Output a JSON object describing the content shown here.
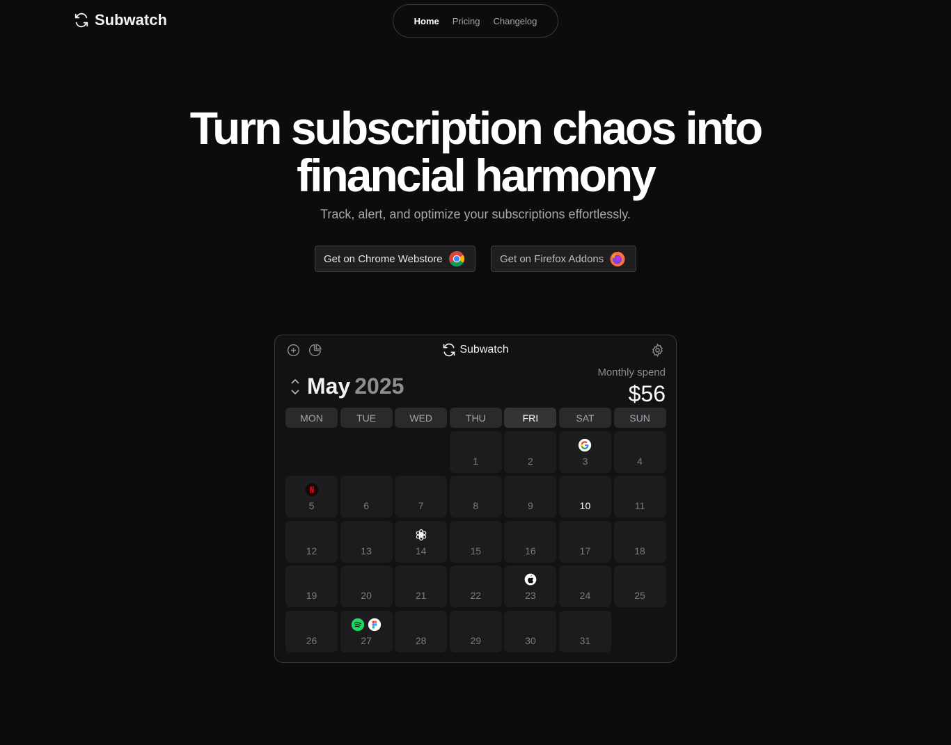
{
  "brand": {
    "name": "Subwatch"
  },
  "nav": {
    "items": [
      "Home",
      "Pricing",
      "Changelog"
    ]
  },
  "hero": {
    "title_line1": "Turn subscription chaos into",
    "title_line2": "financial harmony",
    "subtitle": "Track, alert, and optimize your subscriptions effortlessly.",
    "cta_chrome": "Get on Chrome Webstore",
    "cta_firefox": "Get on Firefox Addons"
  },
  "app": {
    "title": "Subwatch",
    "month": "May",
    "year": "2025",
    "spend_label": "Monthly spend",
    "spend_value": "$56",
    "weekdays": [
      "MON",
      "TUE",
      "WED",
      "THU",
      "FRI",
      "SAT",
      "SUN"
    ],
    "today_weekday": "FRI",
    "days": [
      "1",
      "2",
      "3",
      "4",
      "5",
      "6",
      "7",
      "8",
      "9",
      "10",
      "11",
      "12",
      "13",
      "14",
      "15",
      "16",
      "17",
      "18",
      "19",
      "20",
      "21",
      "22",
      "23",
      "24",
      "25",
      "26",
      "27",
      "28",
      "29",
      "30",
      "31"
    ],
    "leading_empty": 3,
    "current_day": "10",
    "subscriptions": [
      {
        "day": "3",
        "icons": [
          "google-icon"
        ]
      },
      {
        "day": "5",
        "icons": [
          "netflix-icon"
        ]
      },
      {
        "day": "14",
        "icons": [
          "openai-icon"
        ]
      },
      {
        "day": "23",
        "icons": [
          "apple-icon"
        ]
      },
      {
        "day": "27",
        "icons": [
          "spotify-icon",
          "figma-icon"
        ]
      }
    ]
  },
  "colors": {
    "background": "#0c0c0d",
    "card": "#121214",
    "cell": "#1c1c1e",
    "accent_white": "#ffffff"
  }
}
